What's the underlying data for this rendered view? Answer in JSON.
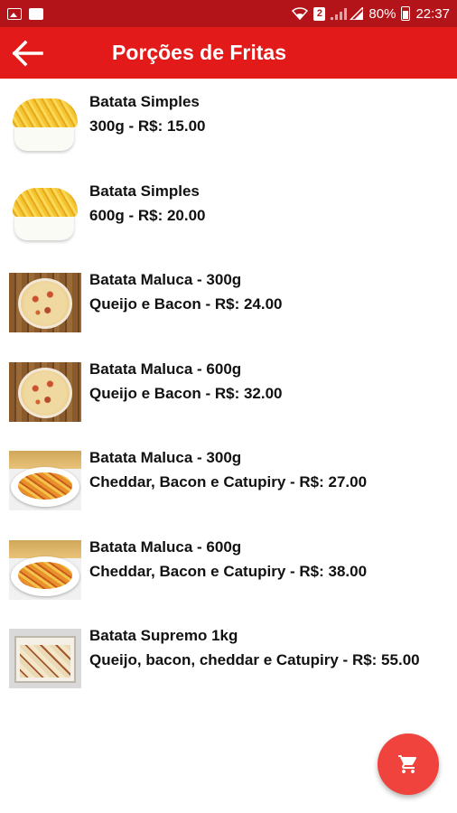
{
  "status_bar": {
    "sim_slot": "2",
    "battery": "80%",
    "time": "22:37",
    "left_icons": [
      "image-icon",
      "news-icon"
    ],
    "right_icons": [
      "wifi-icon",
      "signal-icon",
      "battery-icon"
    ]
  },
  "app_bar": {
    "title": "Porções de Fritas",
    "back_icon": "arrow-left-icon",
    "color": "#e21a1a"
  },
  "items": [
    {
      "title": "Batata Simples",
      "desc": "300g  - R$: 15.00",
      "thumb": "fries"
    },
    {
      "title": "Batata Simples",
      "desc": "600g - R$: 20.00",
      "thumb": "fries"
    },
    {
      "title": "Batata Maluca - 300g",
      "desc": "Queijo e Bacon - R$: 24.00",
      "thumb": "pizza"
    },
    {
      "title": "Batata Maluca - 600g",
      "desc": "Queijo e Bacon - R$: 32.00",
      "thumb": "pizza"
    },
    {
      "title": "Batata Maluca - 300g",
      "desc": "Cheddar, Bacon e Catupiry - R$: 27.00",
      "thumb": "cheddar"
    },
    {
      "title": "Batata Maluca - 600g",
      "desc": "Cheddar, Bacon e Catupiry - R$: 38.00",
      "thumb": "cheddar"
    },
    {
      "title": "Batata Supremo 1kg",
      "desc": "Queijo, bacon, cheddar e Catupiry - R$: 55.00",
      "thumb": "supremo"
    }
  ],
  "fab": {
    "icon": "cart-icon",
    "color": "#f1433d"
  }
}
